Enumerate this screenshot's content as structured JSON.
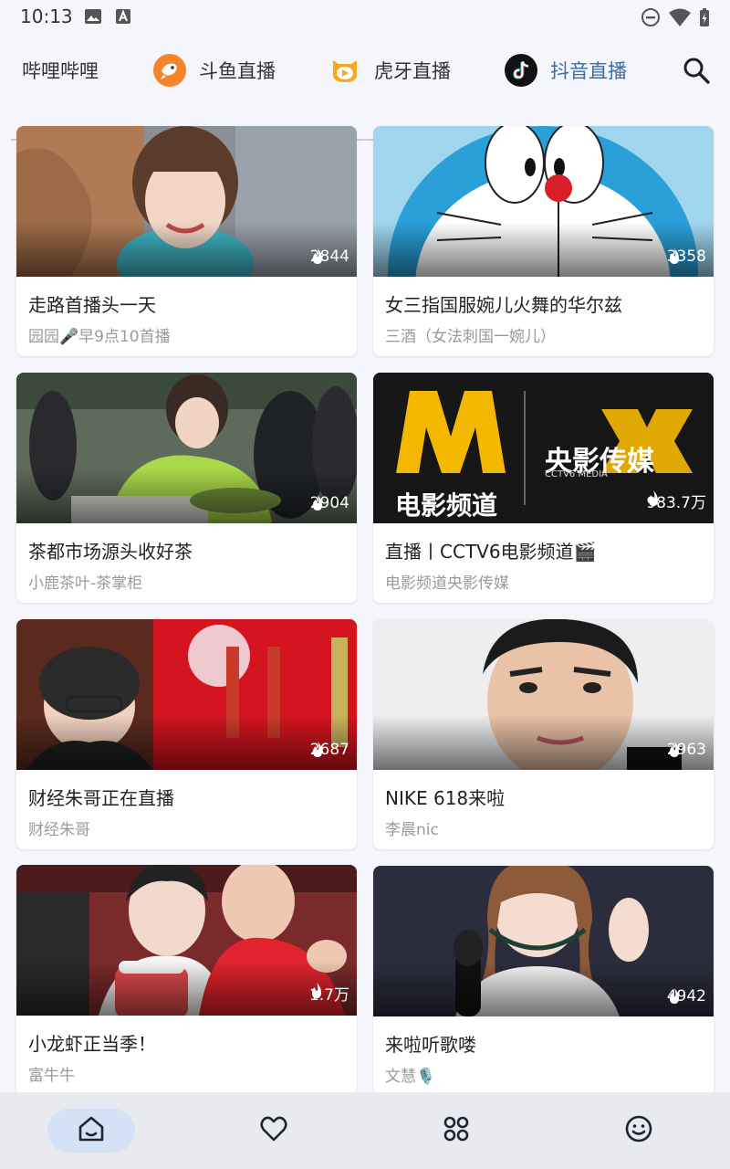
{
  "status_bar": {
    "time": "10:13",
    "icons": [
      "image-icon",
      "text-icon",
      "dnd-icon",
      "wifi-icon",
      "battery-charging-icon"
    ]
  },
  "tabs": [
    {
      "label": "哔哩哔哩",
      "icon": "none",
      "active": false
    },
    {
      "label": "斗鱼直播",
      "icon": "douyu-logo-icon",
      "active": false
    },
    {
      "label": "虎牙直播",
      "icon": "huya-logo-icon",
      "active": false
    },
    {
      "label": "抖音直播",
      "icon": "douyin-logo-icon",
      "active": true
    }
  ],
  "search": {
    "icon": "search-icon"
  },
  "cards": [
    {
      "title": "走路首播头一天",
      "streamer": "园园🎤早9点10首播",
      "viewers": "2844"
    },
    {
      "title": "女三指国服婉儿火舞的华尔兹",
      "streamer": "三酒（女法刺国一婉儿）",
      "viewers": "3358"
    },
    {
      "title": "茶都市场源头收好茶",
      "streamer": "小鹿茶叶-茶掌柜",
      "viewers": "2904"
    },
    {
      "title": "直播丨CCTV6电影频道🎬",
      "streamer": "电影频道央影传媒",
      "viewers": "983.7万"
    },
    {
      "title": "财经朱哥正在直播",
      "streamer": "财经朱哥",
      "viewers": "2687"
    },
    {
      "title": "NIKE 618来啦",
      "streamer": "李晨nic",
      "viewers": "2963"
    },
    {
      "title": "小龙虾正当季！",
      "streamer": "富牛牛",
      "viewers": "1.7万"
    },
    {
      "title": "来啦听歌喽",
      "streamer": "文慧🎙️",
      "viewers": "4942"
    }
  ],
  "thumb_text": {
    "cctv_channel": "电影频道",
    "cctv_brand": "央影传媒",
    "cctv_brand_en": "CCTV6 MEDIA"
  },
  "bottom_nav": [
    {
      "icon": "home-icon",
      "active": true
    },
    {
      "icon": "heart-icon",
      "active": false
    },
    {
      "icon": "apps-icon",
      "active": false
    },
    {
      "icon": "smiley-icon",
      "active": false
    }
  ],
  "colors": {
    "accent": "#3a6ba8",
    "tab_underline": "#2f5b86",
    "background": "#f5f6fb",
    "nav_background": "#e9eaf0",
    "nav_active_pill": "#d4e2f5"
  }
}
